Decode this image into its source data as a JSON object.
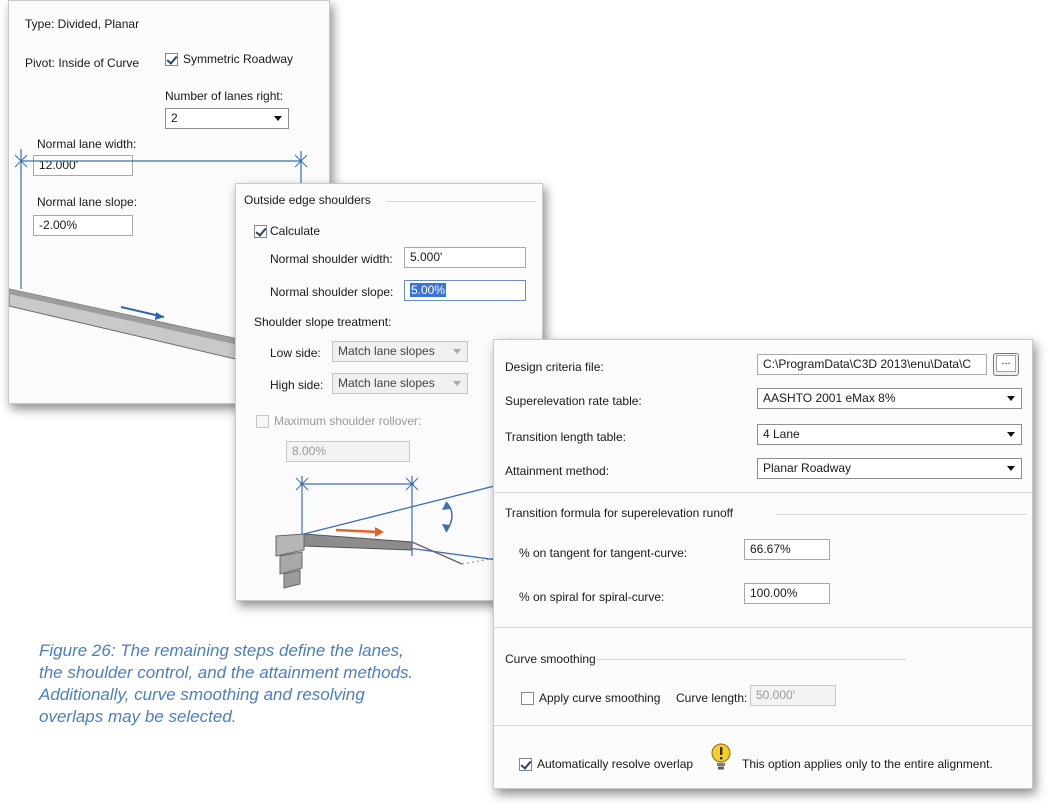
{
  "lanes_panel": {
    "type_text": "Type:  Divided, Planar",
    "pivot_text": "Pivot:  Inside of Curve",
    "symmetric_label": "Symmetric Roadway",
    "lanes_right_label": "Number of lanes right:",
    "lanes_right_value": "2",
    "lane_width_label": "Normal lane width:",
    "lane_width_value": "12.000'",
    "lane_slope_label": "Normal lane slope:",
    "lane_slope_value": "-2.00%"
  },
  "shoulder_panel": {
    "group_title": "Outside edge shoulders",
    "calculate_label": "Calculate",
    "shoulder_width_label": "Normal shoulder width:",
    "shoulder_width_value": "5.000'",
    "shoulder_slope_label": "Normal shoulder slope:",
    "shoulder_slope_value": "5.00%",
    "treatment_label": "Shoulder slope treatment:",
    "low_side_label": "Low side:",
    "low_side_value": "Match lane slopes",
    "high_side_label": "High side:",
    "high_side_value": "Match lane slopes",
    "rollover_label": "Maximum shoulder rollover:",
    "rollover_value": "8.00%"
  },
  "criteria_panel": {
    "criteria_file_label": "Design criteria file:",
    "criteria_file_value": "C:\\ProgramData\\C3D 2013\\enu\\Data\\C",
    "browse_label": "...",
    "rate_table_label": "Superelevation rate table:",
    "rate_table_value": "AASHTO 2001 eMax 8%",
    "transition_table_label": "Transition length table:",
    "transition_table_value": "4 Lane",
    "attainment_label": "Attainment method:",
    "attainment_value": "Planar Roadway",
    "formula_title": "Transition formula for superelevation runoff",
    "tangent_label": "% on tangent for tangent-curve:",
    "tangent_value": "66.67%",
    "spiral_label": "% on spiral for spiral-curve:",
    "spiral_value": "100.00%",
    "smoothing_title": "Curve smoothing",
    "apply_smoothing_label": "Apply curve smoothing",
    "curve_length_label": "Curve length:",
    "curve_length_value": "50.000'",
    "resolve_label": "Automatically resolve overlap",
    "resolve_note": "This option applies only to the entire alignment."
  },
  "caption": "Figure 26: The remaining steps define the lanes, the shoulder control, and the attainment methods. Additionally, curve smoothing and resolving overlaps may be selected.",
  "colors": {
    "caption": "#4b7ec2",
    "dimension_line": "#3c6fb5",
    "direction_arrow": "#2f62b0",
    "shoulder_arrow": "#e2632a",
    "selection": "#3875d7",
    "warning_icon": "#f2cf2a"
  }
}
